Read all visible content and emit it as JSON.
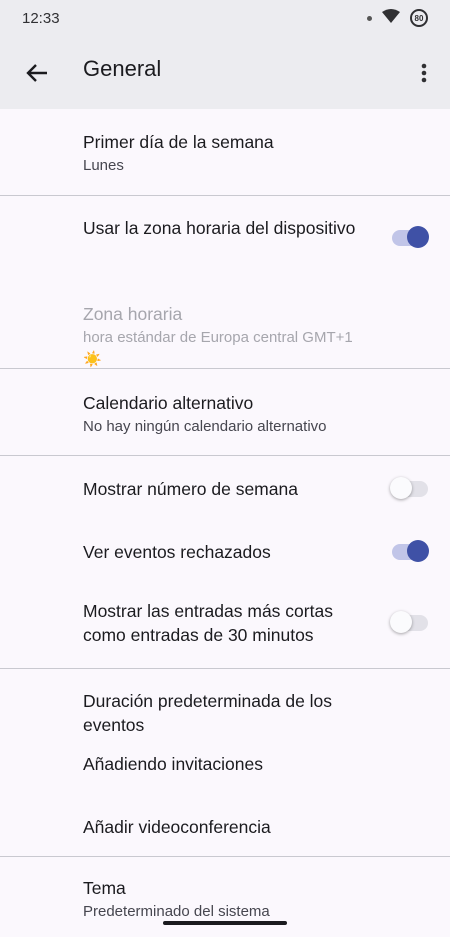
{
  "status_bar": {
    "time": "12:33",
    "battery_level": "80"
  },
  "app_bar": {
    "title": "General"
  },
  "settings": {
    "first_day": {
      "title": "Primer día de la semana",
      "value": "Lunes"
    },
    "device_timezone": {
      "title": "Usar la zona horaria del dispositivo",
      "enabled": true
    },
    "timezone": {
      "title": "Zona horaria",
      "value": "hora estándar de Europa central  GMT+1 ☀️",
      "disabled": true
    },
    "alt_calendar": {
      "title": "Calendario alternativo",
      "value": "No hay ningún calendario alternativo"
    },
    "week_number": {
      "title": "Mostrar número de semana",
      "enabled": false
    },
    "declined_events": {
      "title": "Ver eventos rechazados",
      "enabled": true
    },
    "short_entries": {
      "title": "Mostrar las entradas más cortas como entradas de 30 minutos",
      "enabled": false
    },
    "default_duration": {
      "title": "Duración predeterminada de los eventos"
    },
    "adding_invitations": {
      "title": "Añadiendo invitaciones"
    },
    "add_videoconference": {
      "title": "Añadir videoconferencia"
    },
    "theme": {
      "title": "Tema",
      "value": "Predeterminado del sistema"
    }
  },
  "colors": {
    "accent": "#3f51a6",
    "toggle_track_on": "#c1c5e8",
    "background": "#fbf8fd",
    "app_bar": "#ececf0"
  }
}
